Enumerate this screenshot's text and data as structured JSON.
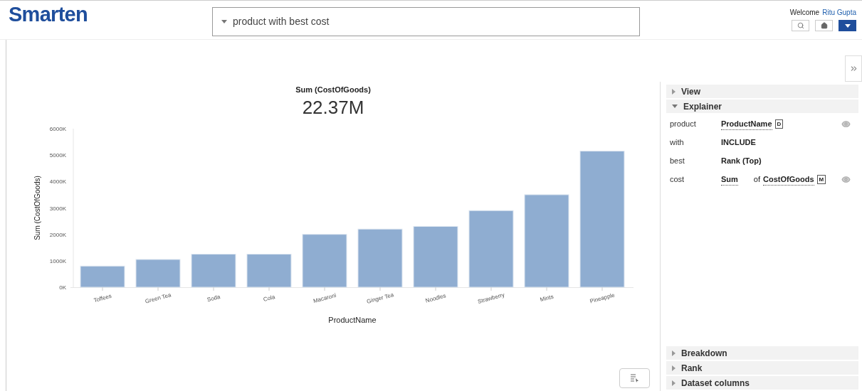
{
  "header": {
    "logo": "Smarten",
    "query": "product with best cost",
    "welcome": "Welcome",
    "user": "Ritu Gupta"
  },
  "kpi": {
    "title": "Sum (CostOfGoods)",
    "value": "22.37M"
  },
  "chart": {
    "chart_data": {
      "type": "bar",
      "xlabel": "ProductName",
      "ylabel": "Sum (CostOfGoods)",
      "categories": [
        "Toffees",
        "Green Tea",
        "Soda",
        "Cola",
        "Macaroni",
        "Ginger Tea",
        "Noodles",
        "Strawberry",
        "Mints",
        "Pineapple"
      ],
      "series": [
        {
          "color": "#8fadd1",
          "values": [
            800,
            1050,
            1250,
            1250,
            2000,
            2200,
            2300,
            2900,
            3500,
            5150
          ]
        }
      ],
      "ylim": [
        0,
        6000
      ],
      "yticks": [
        {
          "value": 0,
          "label": "0K"
        },
        {
          "value": 1000,
          "label": "1000K"
        },
        {
          "value": 2000,
          "label": "2000K"
        },
        {
          "value": 3000,
          "label": "3000K"
        },
        {
          "value": 4000,
          "label": "4000K"
        },
        {
          "value": 5000,
          "label": "5000K"
        },
        {
          "value": 6000,
          "label": "6000K"
        }
      ]
    }
  },
  "panel": {
    "sections_top": [
      {
        "title": "View",
        "expanded": false
      },
      {
        "title": "Explainer",
        "expanded": true
      }
    ],
    "explainer": [
      {
        "kind": "field",
        "label": "product",
        "value": "ProductName",
        "badge": "D"
      },
      {
        "kind": "plain",
        "label": "with",
        "value": "INCLUDE"
      },
      {
        "kind": "plain",
        "label": "best",
        "value": "Rank (Top)"
      },
      {
        "kind": "measure",
        "label": "cost",
        "value": "Sum",
        "of": "of",
        "field": "CostOfGoods",
        "badge": "M"
      }
    ],
    "sections_bottom": [
      {
        "title": "Breakdown",
        "expanded": false
      },
      {
        "title": "Rank",
        "expanded": false
      },
      {
        "title": "Dataset columns",
        "expanded": false
      }
    ]
  }
}
